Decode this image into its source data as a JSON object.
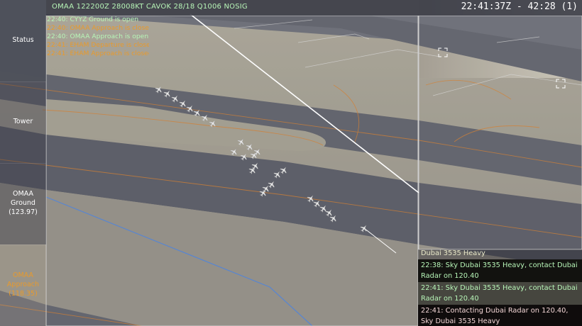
{
  "colors": {
    "accent_green": "#b7f5b7",
    "open_status": "#b7f5b7",
    "closed_status": "#e89a2c",
    "approach_label": "#e89a2c",
    "outgoing_message": "#f3d6d6",
    "taxiway_line": "#d07a2a"
  },
  "sidebar": {
    "status_label": "Status",
    "tower_label": "Tower",
    "ground_label": "OMAA\nGround\n(123.97)",
    "approach_label": "OMAA\nApproach\n(118.35)"
  },
  "topbar": {
    "metar": "OMAA 122200Z 28008KT CAVOK 28/18 Q1006 NOSIG",
    "clock": "22:41:37Z - 42:28 (1)"
  },
  "status_log": [
    {
      "text": "22:40: CYYZ Ground is open",
      "state": "open"
    },
    {
      "text": "22:40: OMAA Approach is closed",
      "state": "closed"
    },
    {
      "text": "22:40: OMAA Approach is open",
      "state": "open"
    },
    {
      "text": "22:41: EHAM Departure is closed",
      "state": "closed"
    },
    {
      "text": "22:41: EHAM Approach is closed",
      "state": "closed"
    }
  ],
  "comms": [
    {
      "text": "Dubai 3535 Heavy",
      "kind": "partial"
    },
    {
      "text": "22:38: Sky Dubai 3535 Heavy, contact Dubai Radar on 120.40",
      "kind": "incoming"
    },
    {
      "text": "22:41: Sky Dubai 3535 Heavy, contact Dubai Radar on 120.40",
      "kind": "incoming"
    },
    {
      "text": "22:41: Contacting Dubai Radar on 120.40, Sky Dubai 3535 Heavy",
      "kind": "outgoing"
    }
  ],
  "icons": {
    "aircraft": "aircraft-icon",
    "gate_marker": "gate-marker-icon"
  }
}
